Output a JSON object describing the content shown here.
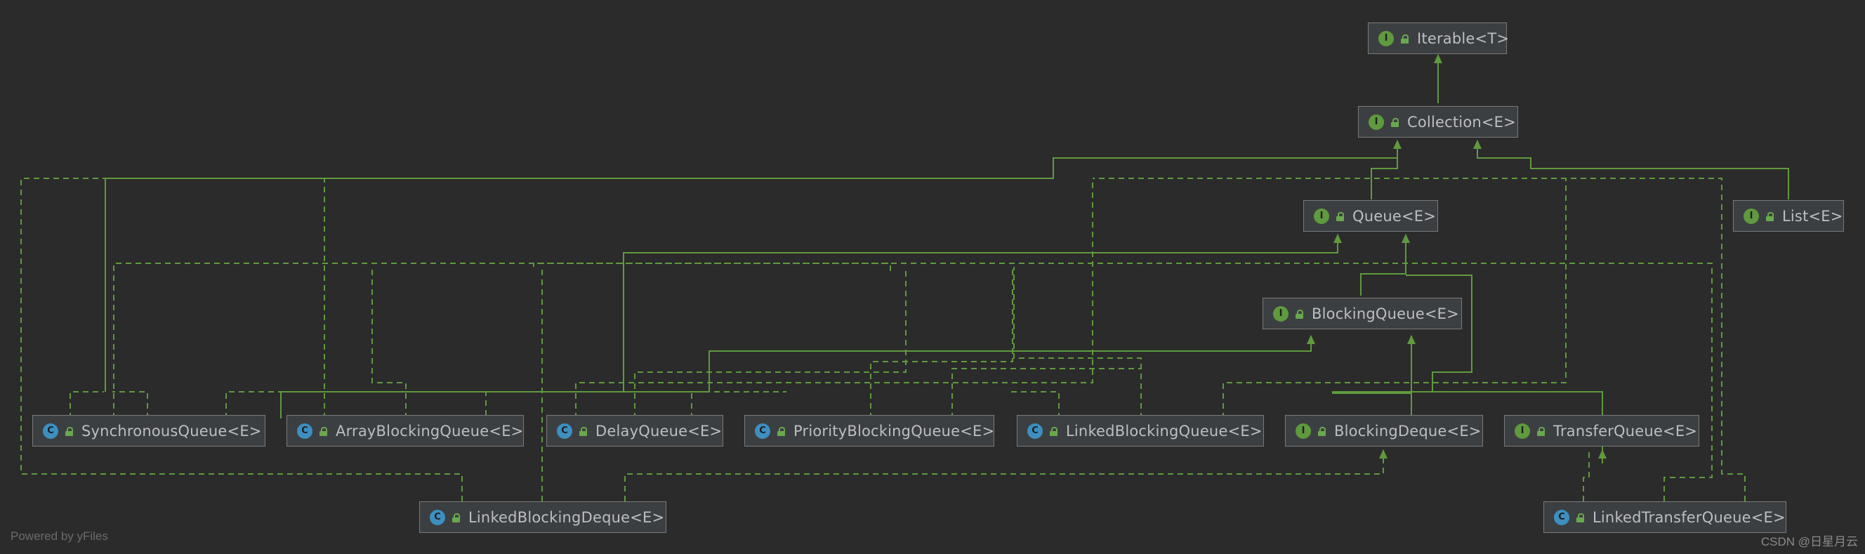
{
  "colors": {
    "background": "#2b2b2b",
    "edge": "#5f9a3e",
    "node_fill": "#3c3f41",
    "node_border": "#7a7a7a",
    "interface_badge": "#5f9a3e",
    "class_badge": "#3d8fc0"
  },
  "nodes": {
    "iterable": {
      "label": "Iterable<T>",
      "kind": "interface",
      "icon": "interface-icon"
    },
    "collection": {
      "label": "Collection<E>",
      "kind": "interface",
      "icon": "interface-icon"
    },
    "queue": {
      "label": "Queue<E>",
      "kind": "interface",
      "icon": "interface-icon"
    },
    "list": {
      "label": "List<E>",
      "kind": "interface",
      "icon": "interface-icon"
    },
    "blocking_queue": {
      "label": "BlockingQueue<E>",
      "kind": "interface",
      "icon": "interface-icon"
    },
    "synchronous_queue": {
      "label": "SynchronousQueue<E>",
      "kind": "class",
      "icon": "class-icon"
    },
    "array_blocking_queue": {
      "label": "ArrayBlockingQueue<E>",
      "kind": "class",
      "icon": "class-icon"
    },
    "delay_queue": {
      "label": "DelayQueue<E>",
      "kind": "class",
      "icon": "class-icon"
    },
    "priority_blocking_queue": {
      "label": "PriorityBlockingQueue<E>",
      "kind": "class",
      "icon": "class-icon"
    },
    "linked_blocking_queue": {
      "label": "LinkedBlockingQueue<E>",
      "kind": "class",
      "icon": "class-icon"
    },
    "blocking_deque": {
      "label": "BlockingDeque<E>",
      "kind": "interface",
      "icon": "interface-icon"
    },
    "transfer_queue": {
      "label": "TransferQueue<E>",
      "kind": "interface",
      "icon": "interface-icon"
    },
    "linked_blocking_deque": {
      "label": "LinkedBlockingDeque<E>",
      "kind": "class",
      "icon": "class-icon"
    },
    "linked_transfer_queue": {
      "label": "LinkedTransferQueue<E>",
      "kind": "class",
      "icon": "class-icon"
    }
  },
  "badge_letters": {
    "interface": "I",
    "class": "C"
  },
  "edges": [
    {
      "from": "collection",
      "to": "iterable",
      "type": "extends"
    },
    {
      "from": "queue",
      "to": "collection",
      "type": "extends"
    },
    {
      "from": "list",
      "to": "collection",
      "type": "extends"
    },
    {
      "from": "blocking_queue",
      "to": "queue",
      "type": "extends"
    },
    {
      "from": "blocking_deque",
      "to": "blocking_queue",
      "type": "extends"
    },
    {
      "from": "transfer_queue",
      "to": "blocking_queue",
      "type": "extends"
    },
    {
      "from": "blocking_deque",
      "to": "queue",
      "type": "extends"
    },
    {
      "from": "delay_queue",
      "to": "blocking_queue",
      "type": "implements"
    },
    {
      "from": "priority_blocking_queue",
      "to": "blocking_queue",
      "type": "implements"
    },
    {
      "from": "linked_blocking_queue",
      "to": "blocking_queue",
      "type": "implements"
    },
    {
      "from": "synchronous_queue",
      "to": "collection",
      "type": "implements"
    },
    {
      "from": "linked_blocking_deque",
      "to": "blocking_deque",
      "type": "implements"
    },
    {
      "from": "linked_transfer_queue",
      "to": "transfer_queue",
      "type": "implements"
    }
  ],
  "footer": "Powered by yFiles",
  "watermark": "CSDN @日星月云"
}
